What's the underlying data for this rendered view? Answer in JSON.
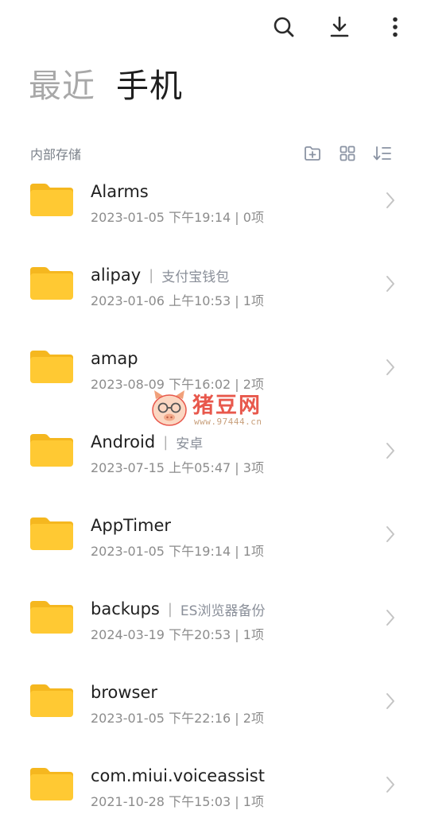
{
  "toolbar": {
    "icons": [
      "search-icon",
      "download-icon",
      "more-vertical-icon"
    ]
  },
  "tabs": [
    {
      "label": "最近",
      "active": false
    },
    {
      "label": "手机",
      "active": true
    }
  ],
  "section": {
    "title": "内部存储",
    "tools": [
      "new-folder-icon",
      "grid-view-icon",
      "sort-icon"
    ]
  },
  "colors": {
    "folder": "#FFC933",
    "folder_back": "#F5B71F",
    "icon": "#2b2b2b",
    "tool_icon": "#8a93a3",
    "watermark": "#E8584C"
  },
  "files": [
    {
      "name": "Alarms",
      "alias": "",
      "date": "2023-01-05",
      "time": "下午19:14",
      "count": "0项"
    },
    {
      "name": "alipay",
      "alias": "支付宝钱包",
      "date": "2023-01-06",
      "time": "上午10:53",
      "count": "1项"
    },
    {
      "name": "amap",
      "alias": "",
      "date": "2023-08-09",
      "time": "下午16:02",
      "count": "2项"
    },
    {
      "name": "Android",
      "alias": "安卓",
      "date": "2023-07-15",
      "time": "上午05:47",
      "count": "3项"
    },
    {
      "name": "AppTimer",
      "alias": "",
      "date": "2023-01-05",
      "time": "下午19:14",
      "count": "1项"
    },
    {
      "name": "backups",
      "alias": "ES浏览器备份",
      "date": "2024-03-19",
      "time": "下午20:53",
      "count": "1项"
    },
    {
      "name": "browser",
      "alias": "",
      "date": "2023-01-05",
      "time": "下午22:16",
      "count": "2项"
    },
    {
      "name": "com.miui.voiceassist",
      "alias": "",
      "date": "2021-10-28",
      "time": "下午15:03",
      "count": "1项"
    }
  ],
  "watermark": {
    "text": "猪豆网",
    "url": "www.97444.cn"
  }
}
